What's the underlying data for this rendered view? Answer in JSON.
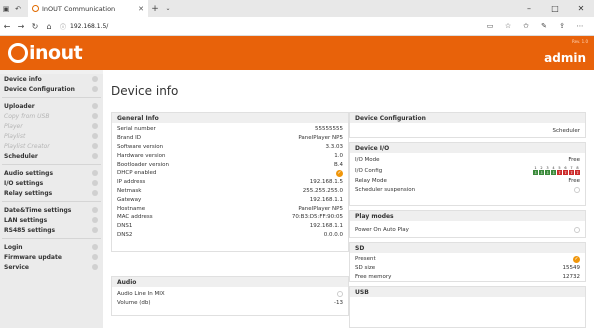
{
  "browser": {
    "tab_title": "InOUT Communication",
    "url": "192.168.1.5/"
  },
  "header": {
    "logo_text": "inout",
    "user_small": "Rev. 1.0",
    "user": "admin",
    "accent": "#e8620a"
  },
  "sidebar": {
    "items": [
      {
        "label": "Device info",
        "dim": false
      },
      {
        "label": "Device Configuration",
        "dim": false
      },
      {
        "label": "Uploader",
        "dim": false
      },
      {
        "label": "Copy from USB",
        "dim": true
      },
      {
        "label": "Player",
        "dim": true
      },
      {
        "label": "Playlist",
        "dim": true
      },
      {
        "label": "Playlist Creator",
        "dim": true
      },
      {
        "label": "Scheduler",
        "dim": false
      },
      {
        "label": "Audio settings",
        "dim": false
      },
      {
        "label": "I/O settings",
        "dim": false
      },
      {
        "label": "Relay settings",
        "dim": false
      },
      {
        "label": "Date&Time settings",
        "dim": false
      },
      {
        "label": "LAN settings",
        "dim": false
      },
      {
        "label": "RS485 settings",
        "dim": false
      },
      {
        "label": "Login",
        "dim": false
      },
      {
        "label": "Firmware update",
        "dim": false
      },
      {
        "label": "Service",
        "dim": false
      }
    ]
  },
  "page": {
    "title": "Device info"
  },
  "general_info": {
    "title": "General Info",
    "rows": [
      {
        "label": "Serial number",
        "value": "55555555"
      },
      {
        "label": "Brand ID",
        "value": "PanelPlayer NP5"
      },
      {
        "label": "Software version",
        "value": "3.3.03"
      },
      {
        "label": "Hardware version",
        "value": "1.0"
      },
      {
        "label": "Bootloader version",
        "value": "B.4"
      },
      {
        "label": "DHCP enabled",
        "value": ""
      },
      {
        "label": "IP address",
        "value": "192.168.1.5"
      },
      {
        "label": "Netmask",
        "value": "255.255.255.0"
      },
      {
        "label": "Gateway",
        "value": "192.168.1.1"
      },
      {
        "label": "Hostname",
        "value": "PanelPlayer NP5"
      },
      {
        "label": "MAC address",
        "value": "70:B3:D5:FF:90:05"
      },
      {
        "label": "DNS1",
        "value": "192.168.1.1"
      },
      {
        "label": "DNS2",
        "value": "0.0.0.0"
      }
    ]
  },
  "audio": {
    "title": "Audio",
    "rows": [
      {
        "label": "Audio Line In MIX",
        "value": ""
      },
      {
        "label": "Volume (db)",
        "value": "-13"
      }
    ]
  },
  "device_config": {
    "title": "Device Configuration",
    "value": "Scheduler"
  },
  "device_io": {
    "title": "Device I/O",
    "io_mode_label": "I/O Mode",
    "io_mode_value": "Free",
    "io_config_label": "I/O Config",
    "io_cells": [
      {
        "n": "1",
        "color": "#3a8a3a"
      },
      {
        "n": "2",
        "color": "#3a8a3a"
      },
      {
        "n": "3",
        "color": "#3a8a3a"
      },
      {
        "n": "4",
        "color": "#3a8a3a"
      },
      {
        "n": "5",
        "color": "#cc2a2a"
      },
      {
        "n": "6",
        "color": "#cc2a2a"
      },
      {
        "n": "7",
        "color": "#cc2a2a"
      },
      {
        "n": "8",
        "color": "#cc2a2a"
      }
    ],
    "relay_label": "Relay Mode",
    "relay_value": "Free",
    "sched_label": "Scheduler suspension"
  },
  "play_modes": {
    "title": "Play modes",
    "label": "Power On Auto Play"
  },
  "sd": {
    "title": "SD",
    "present_label": "Present",
    "size_label": "SD size",
    "size_value": "15549",
    "free_label": "Free memory",
    "free_value": "12732"
  },
  "usb": {
    "title": "USB"
  }
}
